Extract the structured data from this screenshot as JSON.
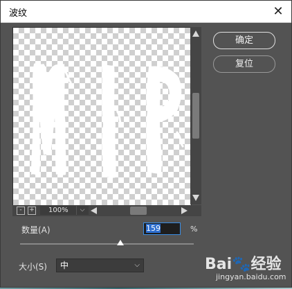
{
  "dialog": {
    "title": "波纹",
    "close_glyph": "✕"
  },
  "buttons": {
    "ok": "确定",
    "reset": "复位"
  },
  "preview": {
    "zoom": "100%",
    "minus": "-",
    "plus": "+",
    "dropdown_glyph": "⌵"
  },
  "amount": {
    "label": "数量(A)",
    "value": "159",
    "unit": "%",
    "slider_level": 0.65
  },
  "size": {
    "label": "大小(S)",
    "value": "中",
    "chevron": "⌵"
  },
  "watermark": {
    "logo": "Bai🐾经验",
    "text": "jingyan.baidu.com"
  },
  "colors": {
    "dialog_bg": "#535353",
    "accent": "#3a8ee6"
  }
}
